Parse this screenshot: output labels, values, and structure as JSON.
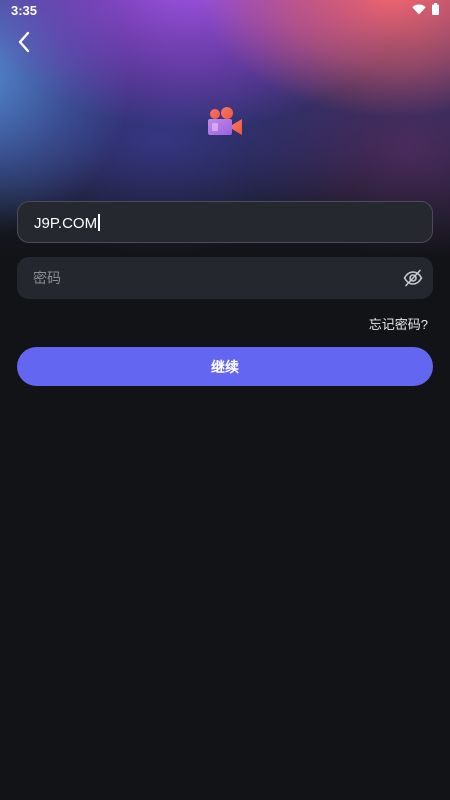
{
  "status_bar": {
    "time": "3:35",
    "icons": [
      "wifi-icon",
      "battery-icon"
    ]
  },
  "header": {
    "back_icon": "chevron-left-icon",
    "logo_icon": "video-camera-icon"
  },
  "form": {
    "username_value": "J9P.COM",
    "password_placeholder": "密码",
    "password_toggle_icon": "eye-off-icon",
    "forgot_label": "忘记密码?",
    "continue_label": "继续"
  },
  "colors": {
    "background": "#121316",
    "field": "#25272e",
    "accent": "#6366f1",
    "logo_orange": "#f26b4e",
    "logo_purple": "#b06ee8"
  }
}
